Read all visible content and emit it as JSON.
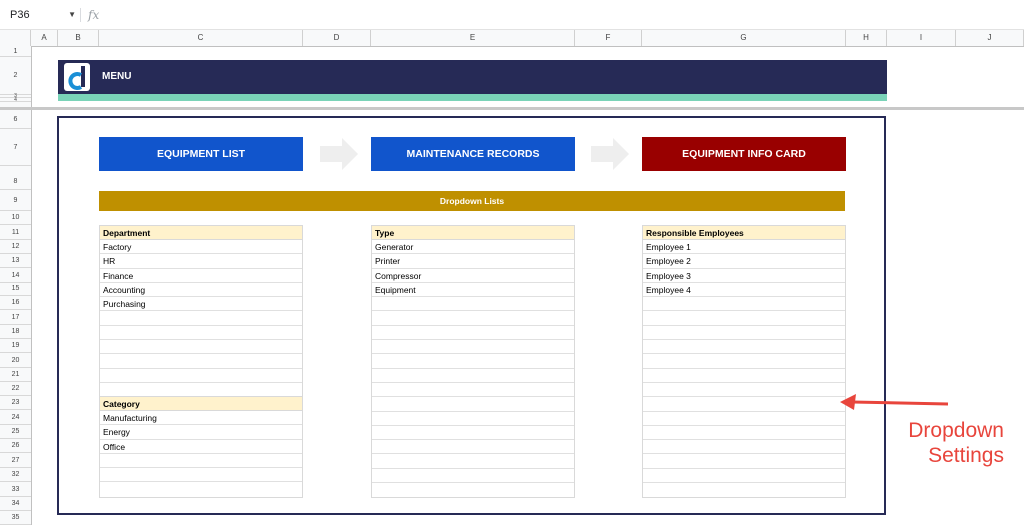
{
  "formula_bar": {
    "cell_ref": "P36",
    "fx_icon": "fx"
  },
  "columns": [
    "A",
    "B",
    "C",
    "D",
    "E",
    "F",
    "G",
    "H",
    "I",
    "J"
  ],
  "rows": [
    "1",
    "2",
    "3",
    "4",
    "6",
    "7",
    "8",
    "9",
    "10",
    "11",
    "12",
    "13",
    "14",
    "15",
    "16",
    "17",
    "18",
    "19",
    "20",
    "21",
    "22",
    "23",
    "24",
    "25",
    "26",
    "27",
    "32",
    "33",
    "34",
    "35"
  ],
  "header": {
    "menu_label": "MENU",
    "colors": {
      "navy": "#262a56",
      "teal": "#7ad3b8"
    }
  },
  "nav": {
    "equipment_list": "EQUIPMENT LIST",
    "maintenance_records": "MAINTENANCE RECORDS",
    "equipment_info_card": "EQUIPMENT INFO CARD",
    "colors": {
      "blue": "#1155cc",
      "red": "#990000"
    }
  },
  "dropdown_title": "Dropdown Lists",
  "lists": {
    "department": {
      "header": "Department",
      "items": [
        "Factory",
        "HR",
        "Finance",
        "Accounting",
        "Purchasing",
        "",
        "",
        "",
        "",
        "",
        ""
      ]
    },
    "category": {
      "header": "Category",
      "items": [
        "Manufacturing",
        "Energy",
        "Office",
        "",
        "",
        ""
      ]
    },
    "type": {
      "header": "Type",
      "items": [
        "Generator",
        "Printer",
        "Compressor",
        "Equipment",
        "",
        "",
        "",
        "",
        "",
        "",
        "",
        "",
        "",
        "",
        "",
        "",
        "",
        ""
      ]
    },
    "employees": {
      "header": "Responsible Employees",
      "items": [
        "Employee 1",
        "Employee 2",
        "Employee 3",
        "Employee 4",
        "",
        "",
        "",
        "",
        "",
        "",
        "",
        "",
        "",
        "",
        "",
        "",
        "",
        ""
      ]
    }
  },
  "annotation": {
    "line1": "Dropdown",
    "line2": "Settings",
    "color": "#e8453c"
  }
}
